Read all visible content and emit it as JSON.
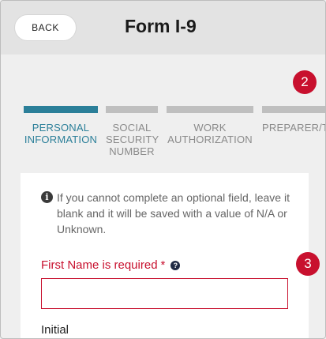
{
  "header": {
    "back_label": "BACK",
    "title": "Form I-9"
  },
  "badges": [
    "2",
    "3"
  ],
  "steps": [
    {
      "lines": [
        "PERSONAL",
        "INFORMATION",
        ""
      ],
      "active": true
    },
    {
      "lines": [
        "SOCIAL",
        "SECURITY",
        "NUMBER"
      ],
      "active": false
    },
    {
      "lines": [
        "WORK",
        "AUTHORIZATION",
        ""
      ],
      "active": false
    },
    {
      "lines": [
        "PREPARER/TI",
        "",
        ""
      ],
      "active": false
    }
  ],
  "info": {
    "text": "If you cannot complete an optional field, leave it blank and it will be saved with a value of N/A or Unknown."
  },
  "first_name": {
    "label": "First Name is required",
    "required_mark": "*",
    "help_icon": "?",
    "value": ""
  },
  "initial": {
    "label": "Initial"
  },
  "colors": {
    "accent": "#2b7f99",
    "error": "#c8102e",
    "inactive": "#bfbfbf"
  }
}
